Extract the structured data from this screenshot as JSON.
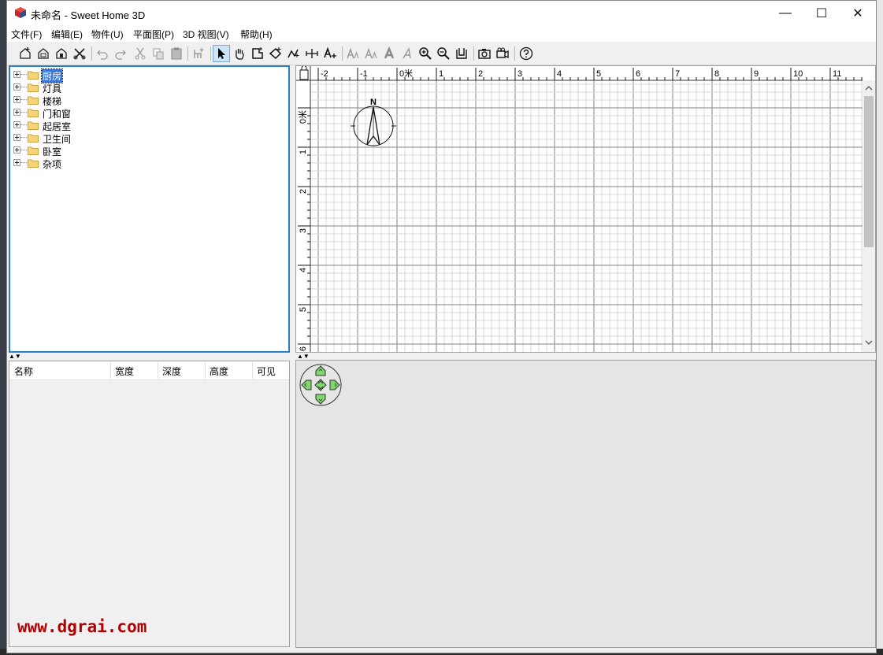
{
  "window": {
    "title": "未命名 - Sweet Home 3D",
    "controls": {
      "minimize": "—",
      "maximize": "☐",
      "close": "✕"
    }
  },
  "menu": [
    "文件(F)",
    "编辑(E)",
    "物件(U)",
    "平面图(P)",
    "3D 视图(V)",
    "帮助(H)"
  ],
  "toolbar": {
    "buttons": [
      {
        "icon": "new-home-icon"
      },
      {
        "icon": "open-icon"
      },
      {
        "icon": "save-icon"
      },
      {
        "icon": "cut-scissors-tools-icon"
      },
      {
        "icon": "undo-icon"
      },
      {
        "icon": "redo-icon"
      },
      {
        "icon": "cut-icon"
      },
      {
        "icon": "copy-icon"
      },
      {
        "icon": "paste-icon"
      },
      {
        "icon": "add-furniture-icon"
      },
      {
        "icon": "select-mode-icon",
        "selected": true
      },
      {
        "icon": "pan-mode-icon"
      },
      {
        "icon": "create-walls-icon"
      },
      {
        "icon": "create-rooms-icon"
      },
      {
        "icon": "create-polylines-icon"
      },
      {
        "icon": "create-dimensions-icon"
      },
      {
        "icon": "add-text-icon"
      },
      {
        "icon": "increase-text-icon"
      },
      {
        "icon": "decrease-text-icon"
      },
      {
        "icon": "bold-text-icon"
      },
      {
        "icon": "italic-text-icon"
      },
      {
        "icon": "zoom-in-icon"
      },
      {
        "icon": "zoom-out-icon"
      },
      {
        "icon": "import-furniture-icon"
      },
      {
        "icon": "create-photo-icon"
      },
      {
        "icon": "create-video-icon"
      },
      {
        "icon": "help-icon"
      }
    ]
  },
  "catalog": {
    "categories": [
      "厨房",
      "灯具",
      "楼梯",
      "门和窗",
      "起居室",
      "卫生间",
      "卧室",
      "杂项"
    ],
    "selected_index": 0
  },
  "furniture_table": {
    "columns": [
      "名称",
      "宽度",
      "深度",
      "高度",
      "可见"
    ]
  },
  "plan": {
    "x_ruler": [
      "-2",
      "-1",
      "0米",
      "1",
      "2",
      "3",
      "4",
      "5",
      "6",
      "7",
      "8",
      "9",
      "10",
      "11"
    ],
    "y_ruler": [
      "0米",
      "1",
      "2",
      "3",
      "4",
      "5",
      "6"
    ],
    "compass_label": "N"
  },
  "watermark": "www.dgrai.com",
  "colors": {
    "selection": "#3875d7",
    "focus_border": "#2a7fc7",
    "nav_arrows": "#7fd66e",
    "watermark": "#b00000"
  }
}
